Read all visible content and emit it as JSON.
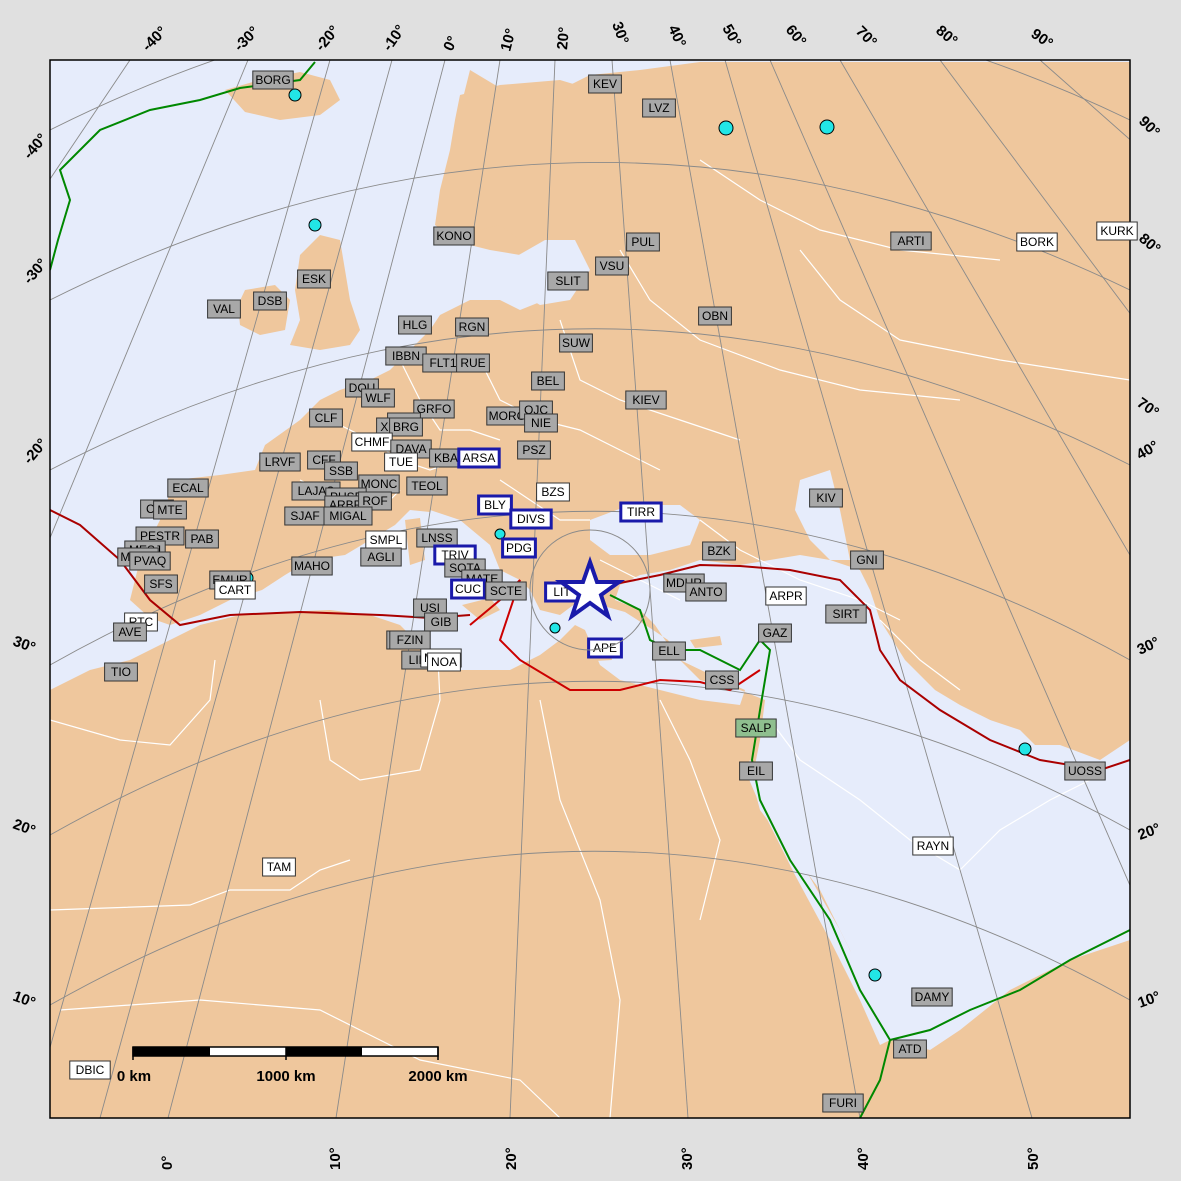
{
  "colors": {
    "sea": "#e6ecfb",
    "land": "#efc79d",
    "border": "#ffffff",
    "graticule": "#8a8a8a",
    "plate_boundary_red": "#c00000",
    "plate_boundary_green": "#008800",
    "station_gray": "#a8a8a8",
    "station_white": "#ffffff",
    "station_green": "#8fbf8f",
    "highlight_box": "#1a1aaa",
    "volcano": "#22e6e6",
    "epicenter": "#1a1aaa"
  },
  "ticks": {
    "top": [
      "-40°",
      "-30°",
      "-20°",
      "-10°",
      "0°",
      "10°",
      "20°",
      "30°",
      "40°",
      "50°",
      "60°",
      "70°",
      "80°",
      "90°"
    ],
    "bottom": [
      "0°",
      "10°",
      "20°",
      "30°",
      "40°",
      "50°"
    ],
    "left": [
      "-40°",
      "-30°",
      "-20°",
      "10°",
      "20°",
      "30°"
    ],
    "right": [
      "90°",
      "80°",
      "70°",
      "40°",
      "30°",
      "20°",
      "10°"
    ]
  },
  "scale_bar": {
    "labels": [
      "0 km",
      "1000 km",
      "2000 km"
    ]
  },
  "epicenter": {
    "icon": "star-icon"
  },
  "stations": [
    {
      "code": "BORG",
      "style": "gray"
    },
    {
      "code": "KEV",
      "style": "gray"
    },
    {
      "code": "LVZ",
      "style": "gray"
    },
    {
      "code": "KONO",
      "style": "gray"
    },
    {
      "code": "PUL",
      "style": "gray"
    },
    {
      "code": "ARTI",
      "style": "gray"
    },
    {
      "code": "BORK",
      "style": "white"
    },
    {
      "code": "KURK",
      "style": "white"
    },
    {
      "code": "VSU",
      "style": "gray"
    },
    {
      "code": "SLIT",
      "style": "gray"
    },
    {
      "code": "ESK",
      "style": "gray"
    },
    {
      "code": "VAL",
      "style": "gray"
    },
    {
      "code": "DSB",
      "style": "gray"
    },
    {
      "code": "HLG",
      "style": "gray"
    },
    {
      "code": "RGN",
      "style": "gray"
    },
    {
      "code": "OBN",
      "style": "gray"
    },
    {
      "code": "SUW",
      "style": "gray"
    },
    {
      "code": "IBBN",
      "style": "gray"
    },
    {
      "code": "FLT1",
      "style": "gray"
    },
    {
      "code": "RUE",
      "style": "gray"
    },
    {
      "code": "BEL",
      "style": "gray"
    },
    {
      "code": "DOU",
      "style": "gray"
    },
    {
      "code": "WLF",
      "style": "gray"
    },
    {
      "code": "GRFO",
      "style": "gray"
    },
    {
      "code": "KIEV",
      "style": "gray"
    },
    {
      "code": "CLF",
      "style": "gray"
    },
    {
      "code": "STU",
      "style": "gray"
    },
    {
      "code": "XBO",
      "style": "gray"
    },
    {
      "code": "BRG",
      "style": "gray"
    },
    {
      "code": "MORC",
      "style": "gray"
    },
    {
      "code": "OJC",
      "style": "gray"
    },
    {
      "code": "NIE",
      "style": "gray"
    },
    {
      "code": "CHMF",
      "style": "white"
    },
    {
      "code": "DAVA",
      "style": "gray"
    },
    {
      "code": "PSZ",
      "style": "gray"
    },
    {
      "code": "LRVF",
      "style": "gray"
    },
    {
      "code": "CFF",
      "style": "gray"
    },
    {
      "code": "TUE",
      "style": "white"
    },
    {
      "code": "KBA",
      "style": "gray"
    },
    {
      "code": "ARSA",
      "style": "box"
    },
    {
      "code": "SSB",
      "style": "gray"
    },
    {
      "code": "ECAL",
      "style": "gray"
    },
    {
      "code": "MONC",
      "style": "gray"
    },
    {
      "code": "TEOL",
      "style": "gray"
    },
    {
      "code": "BZS",
      "style": "white"
    },
    {
      "code": "LAJAS",
      "style": "gray"
    },
    {
      "code": "PUSF",
      "style": "gray"
    },
    {
      "code": "ARBF",
      "style": "gray"
    },
    {
      "code": "ROF",
      "style": "gray"
    },
    {
      "code": "KIV",
      "style": "gray"
    },
    {
      "code": "CMI",
      "style": "gray"
    },
    {
      "code": "MTE",
      "style": "gray"
    },
    {
      "code": "BLY",
      "style": "box"
    },
    {
      "code": "SJAF",
      "style": "gray"
    },
    {
      "code": "MIGAL",
      "style": "gray"
    },
    {
      "code": "DIVS",
      "style": "box"
    },
    {
      "code": "TIRR",
      "style": "box"
    },
    {
      "code": "PESTR",
      "style": "gray"
    },
    {
      "code": "PAB",
      "style": "gray"
    },
    {
      "code": "SMPL",
      "style": "white"
    },
    {
      "code": "LNSS",
      "style": "gray"
    },
    {
      "code": "PDG",
      "style": "box"
    },
    {
      "code": "BZK",
      "style": "gray"
    },
    {
      "code": "MESJ",
      "style": "gray"
    },
    {
      "code": "MORF",
      "style": "gray"
    },
    {
      "code": "PVAQ",
      "style": "gray"
    },
    {
      "code": "AGLI",
      "style": "gray"
    },
    {
      "code": "TRIV",
      "style": "box"
    },
    {
      "code": "GNI",
      "style": "gray"
    },
    {
      "code": "MAHO",
      "style": "gray"
    },
    {
      "code": "SOTA",
      "style": "gray"
    },
    {
      "code": "MATE",
      "style": "gray"
    },
    {
      "code": "MDUR",
      "style": "gray"
    },
    {
      "code": "SFS",
      "style": "gray"
    },
    {
      "code": "EMUR",
      "style": "gray"
    },
    {
      "code": "CART",
      "style": "white"
    },
    {
      "code": "CUC",
      "style": "box"
    },
    {
      "code": "SCTE",
      "style": "gray"
    },
    {
      "code": "LIT",
      "style": "box"
    },
    {
      "code": "ANTO",
      "style": "gray"
    },
    {
      "code": "ARPR",
      "style": "white"
    },
    {
      "code": "USI",
      "style": "gray"
    },
    {
      "code": "SIRT",
      "style": "gray"
    },
    {
      "code": "RTC",
      "style": "white"
    },
    {
      "code": "AVE",
      "style": "gray"
    },
    {
      "code": "GIB",
      "style": "gray"
    },
    {
      "code": "GAZ",
      "style": "gray"
    },
    {
      "code": "PZIN",
      "style": "gray"
    },
    {
      "code": "FZIN",
      "style": "gray"
    },
    {
      "code": "APE",
      "style": "box"
    },
    {
      "code": "ELL",
      "style": "gray"
    },
    {
      "code": "LINA",
      "style": "gray"
    },
    {
      "code": "MLND",
      "style": "white"
    },
    {
      "code": "NOA",
      "style": "white"
    },
    {
      "code": "TIO",
      "style": "gray"
    },
    {
      "code": "CSS",
      "style": "gray"
    },
    {
      "code": "SALP",
      "style": "green"
    },
    {
      "code": "UOSS",
      "style": "gray"
    },
    {
      "code": "EIL",
      "style": "gray"
    },
    {
      "code": "RAYN",
      "style": "white"
    },
    {
      "code": "TAM",
      "style": "white"
    },
    {
      "code": "DAMY",
      "style": "gray"
    },
    {
      "code": "ATD",
      "style": "gray"
    },
    {
      "code": "DBIC",
      "style": "white"
    },
    {
      "code": "FURI",
      "style": "gray"
    }
  ]
}
